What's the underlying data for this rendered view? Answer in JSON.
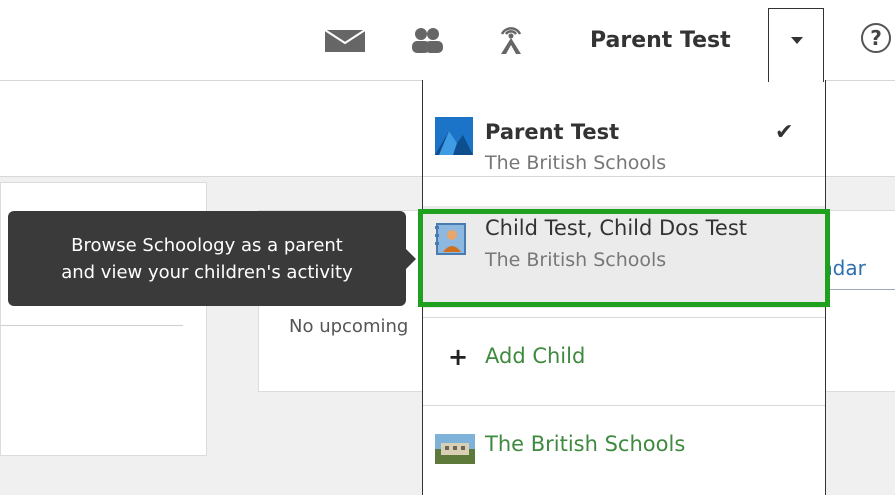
{
  "header": {
    "user_name": "Parent Test",
    "help_glyph": "?",
    "icons": [
      "mail-icon",
      "people-icon",
      "signal-icon",
      "chevron-down-icon",
      "help-icon"
    ]
  },
  "dropdown": {
    "accounts": [
      {
        "name": "Parent Test",
        "school": "The British Schools",
        "selected": true
      },
      {
        "name": "Child Test, Child Dos Test",
        "school": "The British Schools",
        "selected": false
      }
    ],
    "add_child_label": "Add Child",
    "school_link_label": "The British Schools",
    "check_glyph": "✔"
  },
  "tooltip": {
    "line1": "Browse Schoology as a parent",
    "line2": "and view your children's activity"
  },
  "background": {
    "no_upcoming": "No upcoming",
    "calendar_fragment": "ndar"
  },
  "colors": {
    "highlight": "#1fa01f",
    "link_green": "#3e8a3e",
    "tooltip_bg": "#3a3a3a"
  }
}
